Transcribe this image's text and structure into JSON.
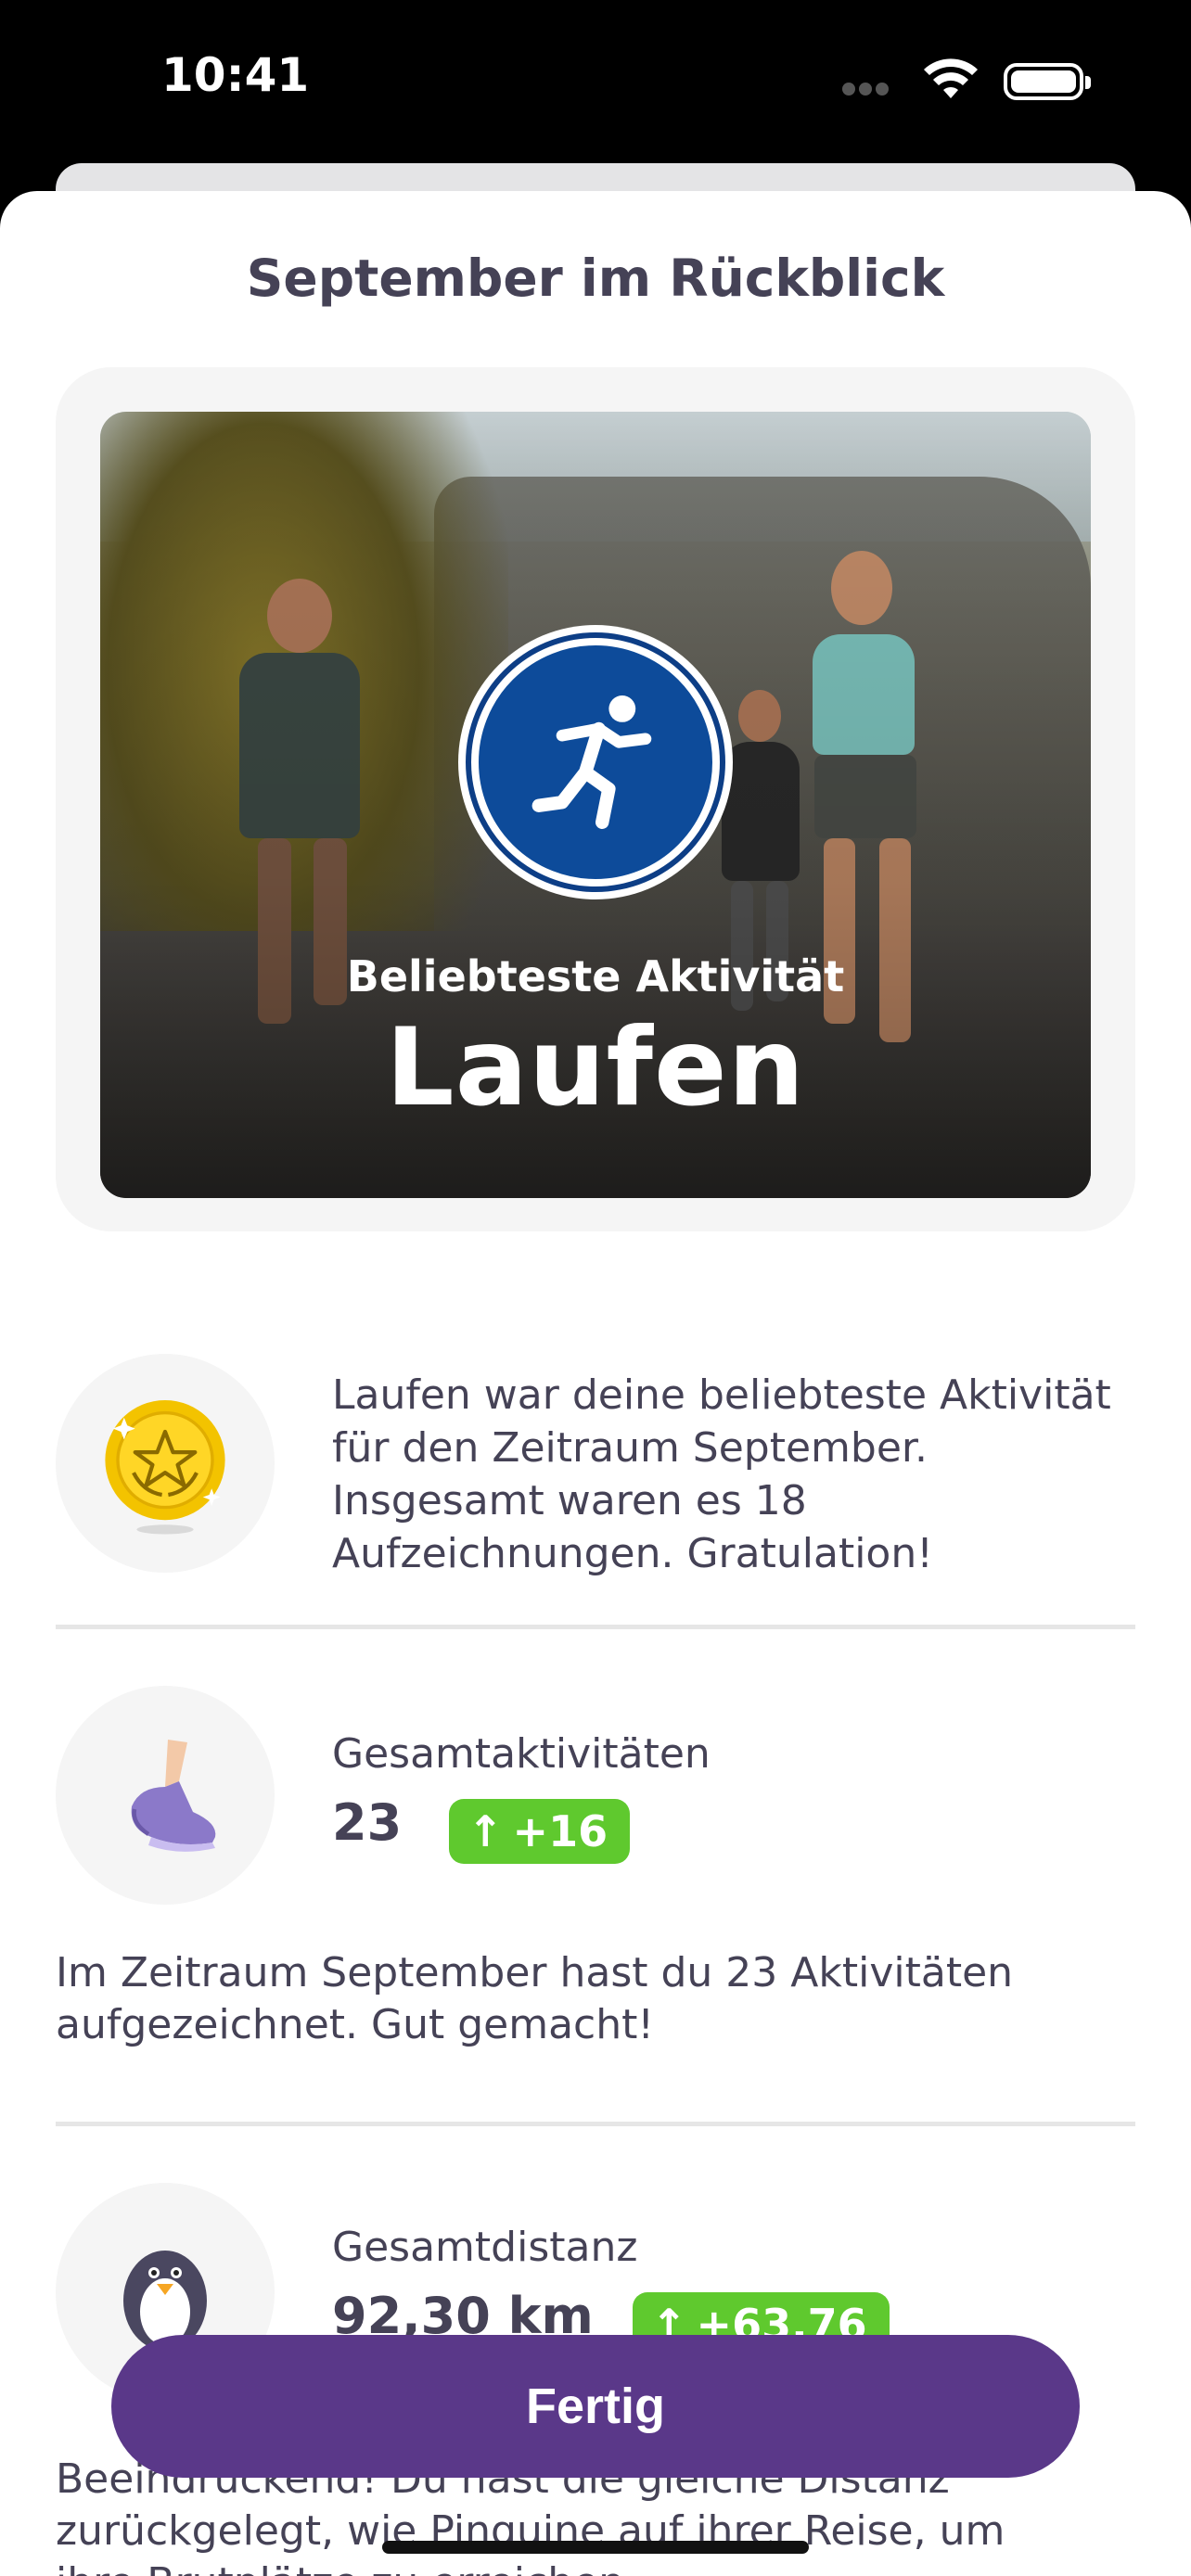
{
  "status_bar": {
    "time": "10:41"
  },
  "sheet": {
    "title": "September im Rückblick"
  },
  "hero": {
    "subtitle": "Beliebteste Aktivität",
    "title": "Laufen",
    "badge_icon": "running-icon"
  },
  "favorite": {
    "icon": "gold-medal-icon",
    "text": "Laufen war deine beliebteste Aktivität für den Zeitraum September. Insgesamt waren es 18 Aufzeichnungen. Gratulation!"
  },
  "total_activities": {
    "icon": "sneaker-icon",
    "label": "Gesamtaktivitäten",
    "value": "23",
    "delta": "+16",
    "description": "Im Zeitraum September hast du 23 Aktivitäten aufgezeichnet. Gut gemacht!"
  },
  "total_distance": {
    "icon": "penguin-icon",
    "label": "Gesamtdistanz",
    "value": "92,30 km",
    "delta": "+63,76",
    "description_line1": "Beeindruckend! Du hast die gleiche Distanz",
    "description_line2": "zurückgelegt, wie Pinguine auf ihrer Reise, um",
    "description_line3": "ihre Brutplätze zu erreichen."
  },
  "actions": {
    "done_label": "Fertig"
  },
  "colors": {
    "accent": "#5a3889",
    "positive": "#5fc92e",
    "text": "#454256",
    "badge_blue": "#0d4b9a"
  }
}
